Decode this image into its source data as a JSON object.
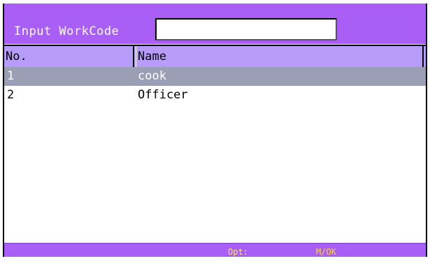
{
  "input": {
    "label": "Input WorkCode",
    "value": "",
    "placeholder": ""
  },
  "table": {
    "columns": [
      "No.",
      "Name"
    ],
    "rows": [
      {
        "no": "1",
        "name": "cook",
        "selected": true
      },
      {
        "no": "2",
        "name": "Officer",
        "selected": false
      }
    ]
  },
  "footer": {
    "opt_label": "Opt:",
    "opt_key": "M/OK"
  },
  "colors": {
    "bar": "#a95ff5",
    "header": "#b89cfc",
    "selected_row": "#9a9fb6",
    "footer_text": "#ffd23a"
  }
}
